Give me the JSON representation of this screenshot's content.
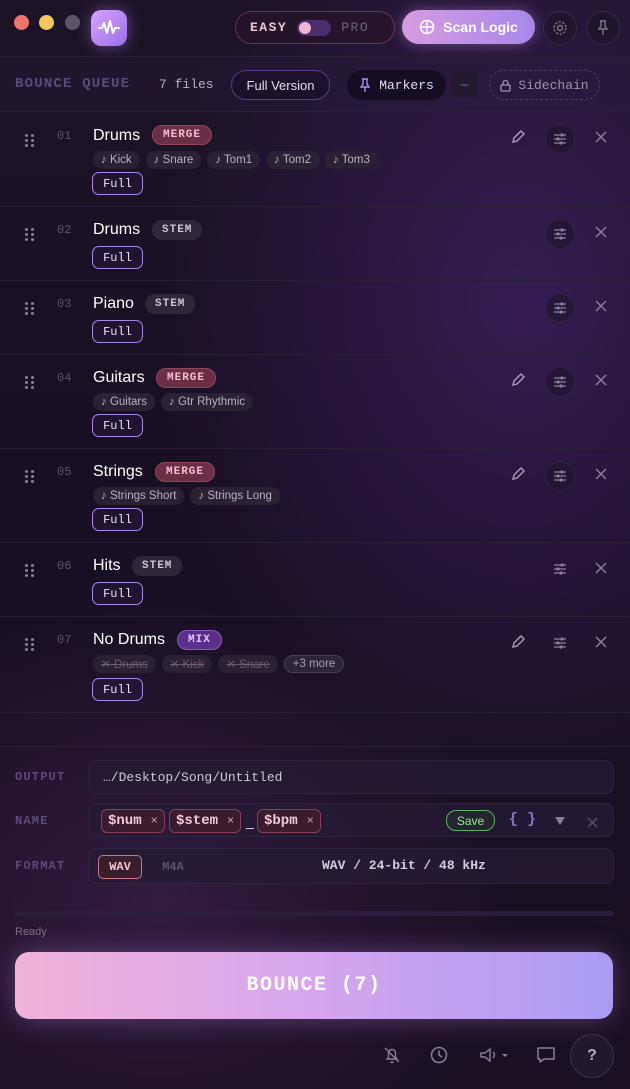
{
  "mode": {
    "easy": "EASY",
    "pro": "PRO"
  },
  "scan_button": "Scan Logic",
  "queue": {
    "title": "BOUNCE QUEUE",
    "count": "7 files",
    "full_version": "Full Version",
    "markers": "Markers",
    "minus": "–",
    "sidechain": "Sidechain"
  },
  "tracks": [
    {
      "num": "01",
      "name": "Drums",
      "type": "MERGE",
      "chips": [
        "♪ Kick",
        "♪ Snare",
        "♪ Tom1",
        "♪ Tom2",
        "♪ Tom3"
      ],
      "full": "Full"
    },
    {
      "num": "02",
      "name": "Drums",
      "type": "STEM",
      "full": "Full"
    },
    {
      "num": "03",
      "name": "Piano",
      "type": "STEM",
      "full": "Full"
    },
    {
      "num": "04",
      "name": "Guitars",
      "type": "MERGE",
      "chips": [
        "♪ Guitars",
        "♪ Gtr Rhythmic"
      ],
      "full": "Full"
    },
    {
      "num": "05",
      "name": "Strings",
      "type": "MERGE",
      "chips": [
        "♪ Strings Short",
        "♪ Strings Long"
      ],
      "full": "Full"
    },
    {
      "num": "06",
      "name": "Hits",
      "type": "STEM",
      "full": "Full"
    },
    {
      "num": "07",
      "name": "No Drums",
      "type": "MIX",
      "chips": [
        "✕ Drums",
        "✕ Kick",
        "✕ Snare"
      ],
      "more": "+3 more",
      "full": "Full"
    }
  ],
  "config": {
    "output_label": "OUTPUT",
    "output_path": "…/Desktop/Song/Untitled",
    "name_label": "NAME",
    "tokens": [
      "$num",
      "$stem",
      "$bpm"
    ],
    "token_remove": "×",
    "separator": "_",
    "save": "Save",
    "braces": "{ }",
    "format_label": "FORMAT",
    "formats": [
      "WAV",
      "M4A"
    ],
    "format_desc": "WAV / 24-bit / 48 kHz"
  },
  "status": "Ready",
  "progress": 0,
  "bounce_button": "BOUNCE (7)",
  "help": "?",
  "colors": {
    "accent_pink": "#f0b3d9",
    "accent_violet": "#a99cf3",
    "merge": "#93455f",
    "mix": "#8a58c2"
  }
}
